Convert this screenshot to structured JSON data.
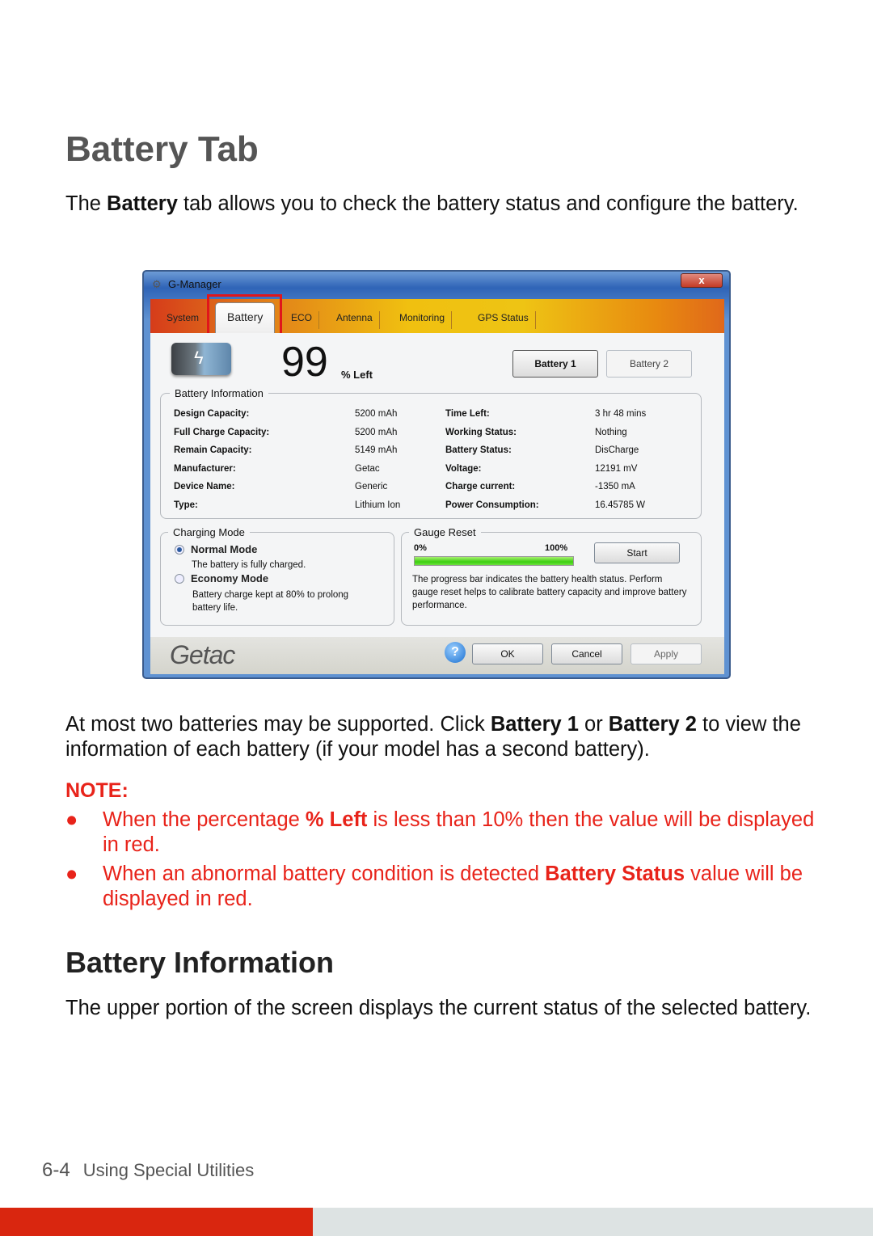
{
  "heading": "Battery Tab",
  "intro": {
    "pre": "The ",
    "bold": "Battery",
    "post": " tab allows you to check the battery status and configure the battery."
  },
  "window": {
    "title": "G-Manager",
    "close": "x",
    "tabs": [
      "System",
      "Battery",
      "ECO",
      "Antenna",
      "Monitoring",
      "GPS Status"
    ],
    "active_tab": "Battery",
    "percent": "99",
    "percent_label": "% Left",
    "battery1": "Battery 1",
    "battery2": "Battery 2",
    "info_title": "Battery Information",
    "info_left": [
      [
        "Design Capacity:",
        "5200 mAh"
      ],
      [
        "Full Charge Capacity:",
        "5200 mAh"
      ],
      [
        "Remain Capacity:",
        "5149 mAh"
      ],
      [
        "Manufacturer:",
        "Getac"
      ],
      [
        "Device Name:",
        "Generic"
      ],
      [
        "Type:",
        "Lithium Ion"
      ]
    ],
    "info_right": [
      [
        "Time Left:",
        "3 hr 48 mins"
      ],
      [
        "Working Status:",
        "Nothing"
      ],
      [
        "Battery Status:",
        "DisCharge"
      ],
      [
        "Voltage:",
        "12191 mV"
      ],
      [
        "Charge current:",
        "-1350 mA"
      ],
      [
        "Power Consumption:",
        "16.45785 W"
      ]
    ],
    "charging": {
      "title": "Charging Mode",
      "normal": "Normal Mode",
      "normal_desc": "The battery is fully charged.",
      "economy": "Economy Mode",
      "economy_desc": "Battery charge kept at 80% to prolong battery life.",
      "selected": "Normal Mode"
    },
    "gauge": {
      "title": "Gauge Reset",
      "min": "0%",
      "max": "100%",
      "progress": 100,
      "start": "Start",
      "desc": "The progress bar indicates the battery health status. Perform gauge reset helps to calibrate battery capacity and improve battery performance."
    },
    "brand": "Getac",
    "help": "?",
    "ok": "OK",
    "cancel": "Cancel",
    "apply": "Apply",
    "accent": "#e0161b"
  },
  "para2": {
    "a": "At most two batteries may be supported. Click ",
    "b1": "Battery 1",
    "c": " or ",
    "b2": "Battery 2",
    "d": " to view the information of each battery (if your model has a second battery)."
  },
  "note": {
    "title": "NOTE:",
    "bullets": [
      {
        "a": "When the percentage ",
        "b": "% Left",
        "c": " is less than 10% then the value will be displayed in red."
      },
      {
        "a": "When an abnormal battery condition is detected ",
        "b": "Battery Status",
        "c": " value will be displayed in red."
      }
    ],
    "color": "#e8231a"
  },
  "heading2": "Battery Information",
  "para3": "The upper portion of the screen displays the current status of the selected battery.",
  "footer": {
    "page": "6-4",
    "section": "Using Special Utilities"
  }
}
